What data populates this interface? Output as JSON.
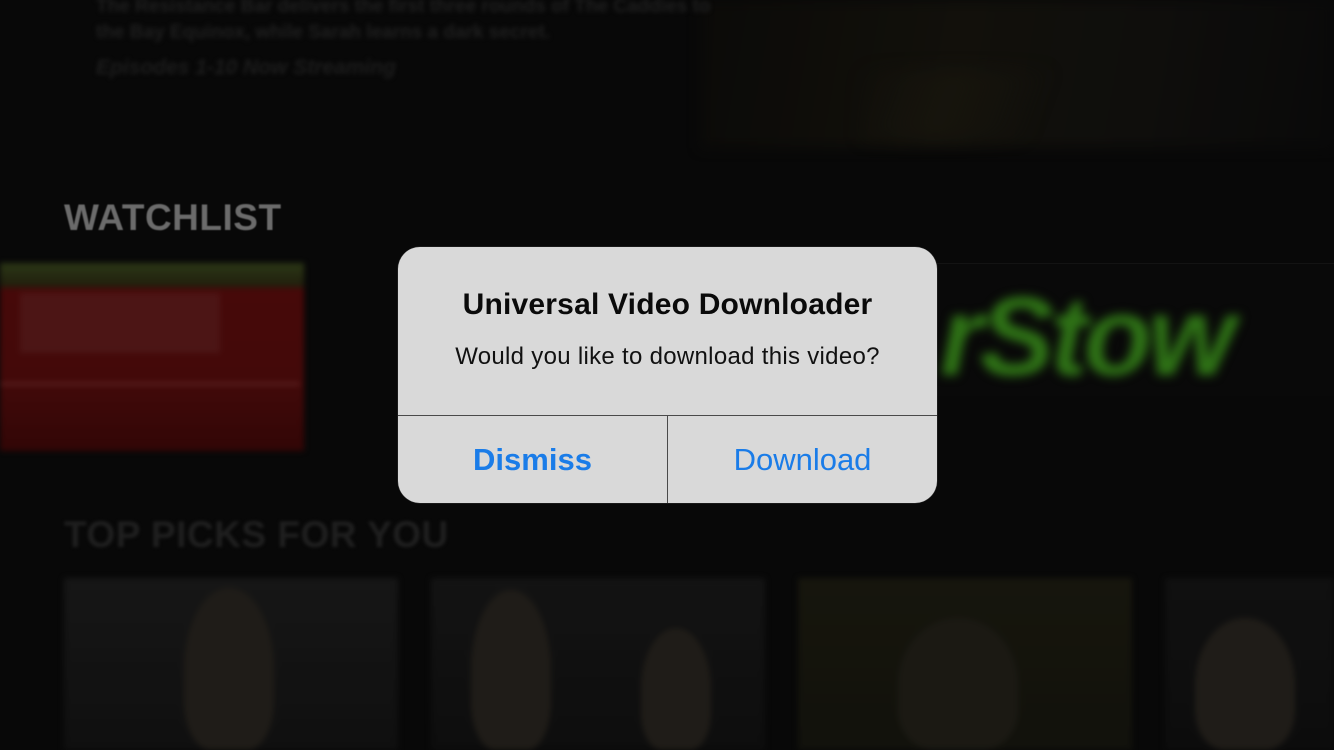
{
  "background": {
    "hero": {
      "description": "The Resistance Bar delivers the first three rounds of The Caddies to the Bay Equinox, while Sarah learns a dark secret.",
      "streaming_label": "Episodes 1-10 Now Streaming"
    },
    "watchlist": {
      "title": "WATCHLIST",
      "card_logo_text": "rStow"
    },
    "top_picks": {
      "title": "TOP PICKS FOR YOU"
    }
  },
  "alert": {
    "title": "Universal Video Downloader",
    "message": "Would you like to download this video?",
    "buttons": {
      "dismiss": "Dismiss",
      "download": "Download"
    },
    "colors": {
      "button_text": "#1a7ce8",
      "background": "#d9d9d9"
    }
  }
}
